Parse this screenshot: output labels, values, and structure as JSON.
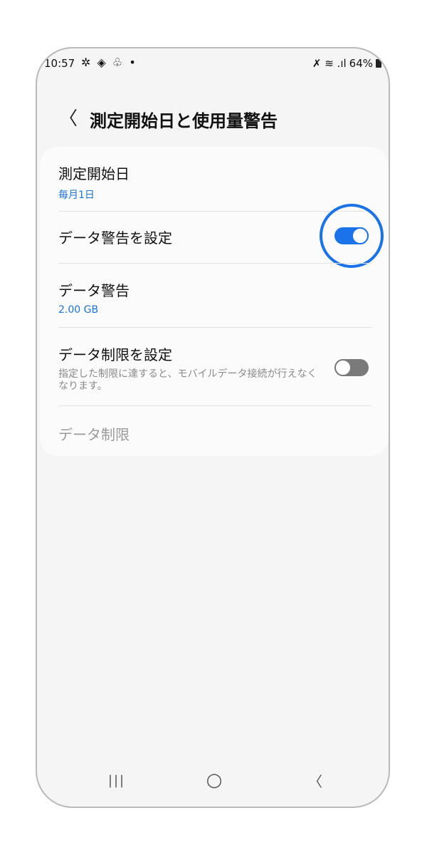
{
  "status_bar": {
    "time": "10:57",
    "notification_icons": "✲ ◈ ♧ •",
    "right_icons": "✗ ≋ .ıl",
    "battery": "64%"
  },
  "header": {
    "back_glyph": "〈",
    "title": "測定開始日と使用量警告"
  },
  "settings": {
    "measurement_start": {
      "label": "測定開始日",
      "value": "毎月1日"
    },
    "data_warning_toggle": {
      "label": "データ警告を設定",
      "state": true
    },
    "data_warning": {
      "label": "データ警告",
      "value": "2.00 GB"
    },
    "data_limit_toggle": {
      "label": "データ制限を設定",
      "description": "指定した制限に達すると、モバイルデータ接続が行えなくなります。",
      "state": false
    },
    "data_limit": {
      "label": "データ制限"
    }
  },
  "navbar": {
    "recents": "|||",
    "home": "○",
    "back": "〈"
  },
  "colors": {
    "accent": "#1a73e8"
  }
}
